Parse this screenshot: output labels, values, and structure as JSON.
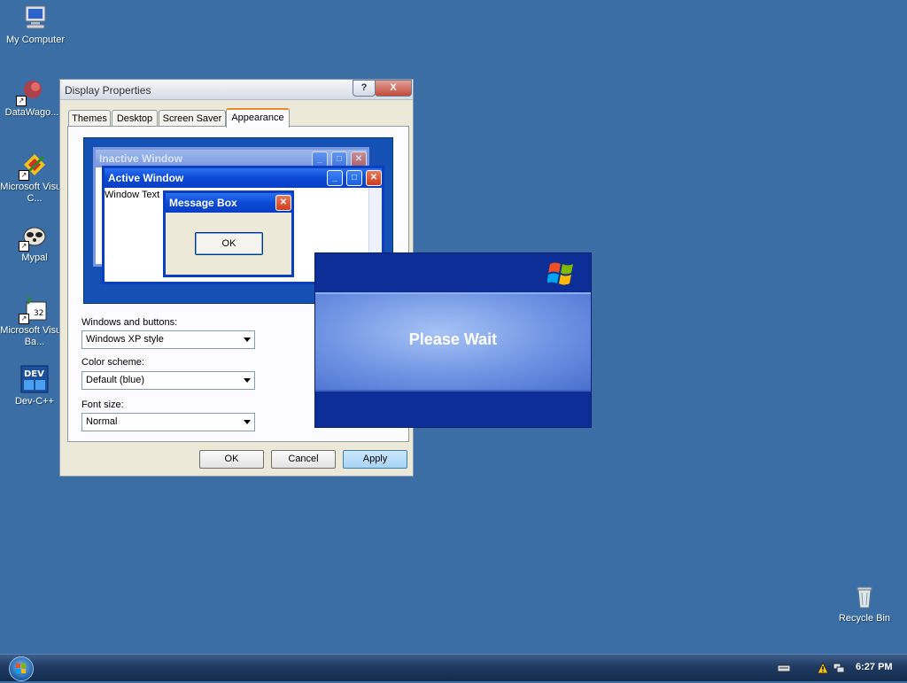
{
  "desktop": {
    "icons": [
      {
        "label": "My Computer",
        "icon": "computer-icon"
      },
      {
        "label": "DataWago...",
        "icon": "datawagon-icon"
      },
      {
        "label": "Microsoft Visual C...",
        "icon": "visual-c-icon"
      },
      {
        "label": "Mypal",
        "icon": "mypal-icon"
      },
      {
        "label": "Microsoft Visual Ba...",
        "icon": "visual-basic-icon"
      },
      {
        "label": "Dev-C++",
        "icon": "devcpp-icon"
      },
      {
        "label": "Recycle Bin",
        "icon": "recycle-bin-icon"
      }
    ]
  },
  "display_properties": {
    "title": "Display Properties",
    "help_label": "?",
    "close_label": "X",
    "tabs": [
      "Themes",
      "Desktop",
      "Screen Saver",
      "Appearance"
    ],
    "active_tab": "Appearance",
    "preview": {
      "inactive_title": "Inactive Window",
      "active_title": "Active Window",
      "window_text": "Window Text",
      "message_title": "Message Box",
      "ok_label": "OK"
    },
    "windows_buttons_label": "Windows and buttons:",
    "windows_buttons_value": "Windows XP style",
    "color_scheme_label": "Color scheme:",
    "color_scheme_value": "Default (blue)",
    "font_size_label": "Font size:",
    "font_size_value": "Normal",
    "buttons": {
      "ok": "OK",
      "cancel": "Cancel",
      "apply": "Apply"
    }
  },
  "splash": {
    "message": "Please Wait"
  },
  "taskbar": {
    "clock": "6:27 PM",
    "tray_icons": [
      "keyboard-icon",
      "security-alert-icon",
      "network-icon"
    ]
  },
  "colors": {
    "desktop": "#3a6ea5",
    "xp_title_blue": "#0a3fc4",
    "splash_dark": "#0c2e96"
  }
}
